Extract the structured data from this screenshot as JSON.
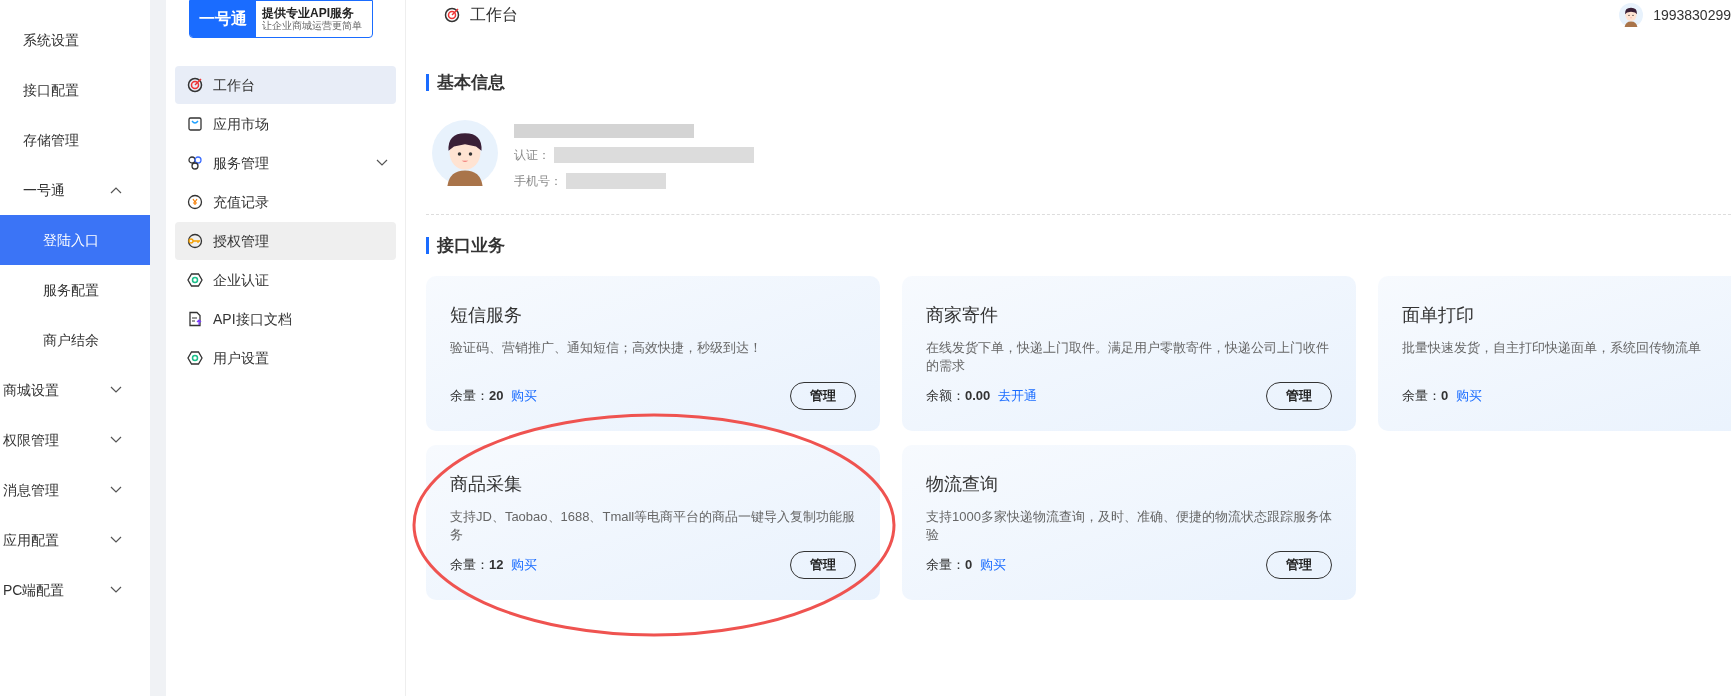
{
  "main_menu": {
    "items": [
      {
        "label": "系统设置",
        "kind": "sub",
        "selected": false
      },
      {
        "label": "接口配置",
        "kind": "sub",
        "selected": false
      },
      {
        "label": "存储管理",
        "kind": "sub",
        "selected": false
      },
      {
        "label": "一号通",
        "kind": "sub",
        "selected": false,
        "expanded": true,
        "children": [
          {
            "label": "登陆入口",
            "selected": true
          },
          {
            "label": "服务配置",
            "selected": false
          },
          {
            "label": "商户结余",
            "selected": false
          }
        ]
      },
      {
        "label": "商城设置",
        "kind": "top",
        "selected": false,
        "expanded": false
      },
      {
        "label": "权限管理",
        "kind": "top",
        "selected": false,
        "expanded": false
      },
      {
        "label": "消息管理",
        "kind": "top",
        "selected": false,
        "expanded": false
      },
      {
        "label": "应用配置",
        "kind": "top",
        "selected": false,
        "expanded": false
      },
      {
        "label": "PC端配置",
        "kind": "top",
        "selected": false,
        "expanded": false
      }
    ]
  },
  "sub_menu": {
    "logo": {
      "badge": "一号通",
      "title": "提供专业API服务",
      "subtitle": "让企业商城运营更简单"
    },
    "items": [
      {
        "label": "工作台",
        "selected": true,
        "hovered": false
      },
      {
        "label": "应用市场",
        "selected": false,
        "hovered": false
      },
      {
        "label": "服务管理",
        "selected": false,
        "hovered": false,
        "expanded": false
      },
      {
        "label": "充值记录",
        "selected": false,
        "hovered": false
      },
      {
        "label": "授权管理",
        "selected": false,
        "hovered": true
      },
      {
        "label": "企业认证",
        "selected": false,
        "hovered": false
      },
      {
        "label": "API接口文档",
        "selected": false,
        "hovered": false
      },
      {
        "label": "用户设置",
        "selected": false,
        "hovered": false
      }
    ]
  },
  "header": {
    "title": "工作台",
    "user": "1993830299"
  },
  "basic_info": {
    "heading": "基本信息",
    "fields": [
      {
        "label": "认证："
      },
      {
        "label": "手机号："
      }
    ]
  },
  "services": {
    "heading": "接口业务",
    "cards": [
      {
        "title": "短信服务",
        "description": "验证码、营销推广、通知短信；高效快捷，秒级到达！",
        "quota_label": "余量：",
        "quota_value": "20",
        "link": "购买",
        "button": "管理"
      },
      {
        "title": "商家寄件",
        "description": "在线发货下单，快递上门取件。满足用户零散寄件，快递公司上门收件的需求",
        "quota_label": "余额：",
        "quota_value": "0.00",
        "link": "去开通",
        "button": "管理"
      },
      {
        "title": "面单打印",
        "description": "批量快速发货，自主打印快递面单，系统回传物流单",
        "quota_label": "余量：",
        "quota_value": "0",
        "link": "购买"
      },
      {
        "title": "商品采集",
        "description": "支持JD、Taobao、1688、Tmall等电商平台的商品一键导入复制功能服务",
        "quota_label": "余量：",
        "quota_value": "12",
        "link": "购买",
        "button": "管理",
        "circled": true
      },
      {
        "title": "物流查询",
        "description": "支持1000多家快递物流查询，及时、准确、便捷的物流状态跟踪服务体验",
        "quota_label": "余量：",
        "quota_value": "0",
        "link": "购买",
        "button": "管理"
      }
    ]
  }
}
